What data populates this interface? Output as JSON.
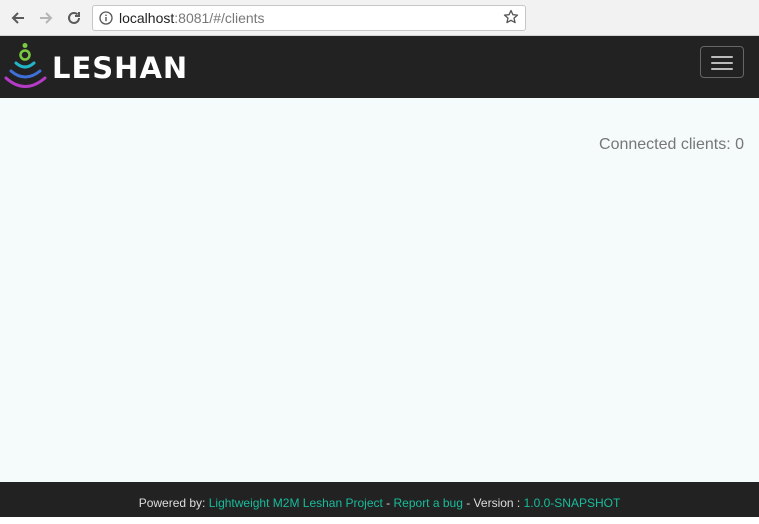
{
  "browser": {
    "url_host": "localhost",
    "url_rest": ":8081/#/clients"
  },
  "header": {
    "brand": "LESHAN",
    "menu_icon": "hamburger-icon"
  },
  "main": {
    "connected_label": "Connected clients: 0"
  },
  "footer": {
    "powered_by": "Powered by: ",
    "project_link": "Lightweight M2M Leshan Project",
    "sep1": " - ",
    "bug_link": "Report a bug",
    "version_label": " - Version : ",
    "version_value": "1.0.0-SNAPSHOT"
  },
  "colors": {
    "header_bg": "#222222",
    "accent": "#18bc9c",
    "main_bg": "#f5fafb"
  }
}
